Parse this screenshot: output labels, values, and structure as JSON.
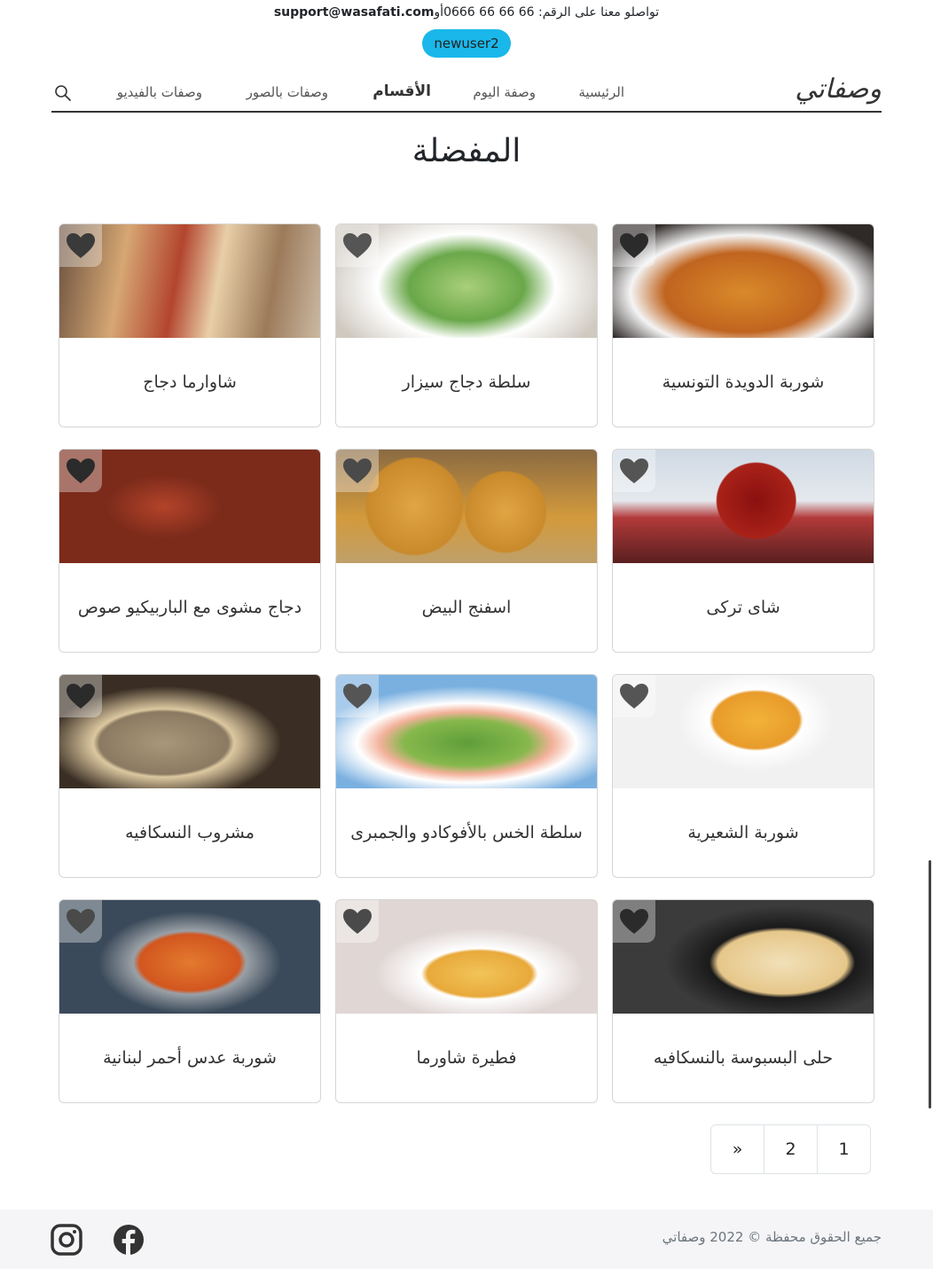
{
  "topbar": {
    "contact_text": "تواصلو معنا على الرقم:  66 66 66 0666أو",
    "email": "support@wasafati.com"
  },
  "user": {
    "name": "newuser2"
  },
  "nav": {
    "logo": "وصفاتي",
    "items": [
      "الرئيسية",
      "وصفة اليوم",
      "الأقسام",
      "وصفات بالصور",
      "وصفات بالفيديو"
    ],
    "active_item": "الأقسام",
    "icon": "search-icon"
  },
  "page_title": "المفضلة",
  "recipes": [
    {
      "title": "شوربة الدويدة التونسية",
      "heart_color": "#2b2b2b"
    },
    {
      "title": "سلطة دجاج سيزار",
      "heart_color": "#555555"
    },
    {
      "title": "شاوارما دجاج",
      "heart_color": "#3a3a3a"
    },
    {
      "title": "شاى تركى",
      "heart_color": "#555555"
    },
    {
      "title": "اسفنج البيض",
      "heart_color": "#4a4a4a"
    },
    {
      "title": "دجاج مشوى مع الباربيكيو صوص",
      "heart_color": "#2b2b2b"
    },
    {
      "title": "شوربة الشعيرية",
      "heart_color": "#555555"
    },
    {
      "title": "سلطة الخس بالأفوكادو والجمبرى",
      "heart_color": "#555555"
    },
    {
      "title": "مشروب النسكافيه",
      "heart_color": "#2b2b2b"
    },
    {
      "title": "حلى البسبوسة بالنسكافيه",
      "heart_color": "#2b2b2b"
    },
    {
      "title": "فطيرة شاورما",
      "heart_color": "#4a4a4a"
    },
    {
      "title": "شوربة عدس أحمر لبنانية",
      "heart_color": "#4a4a4a"
    }
  ],
  "pagination": {
    "pages": [
      "»",
      "2",
      "1"
    ]
  },
  "footer": {
    "copyright": "جميع الحقوق محفظة © 2022 وصفاتي",
    "social": [
      "facebook-icon",
      "instagram-icon"
    ]
  },
  "colors": {
    "accent": "#1ab7ea",
    "footer_bg": "#f5f5f7"
  }
}
